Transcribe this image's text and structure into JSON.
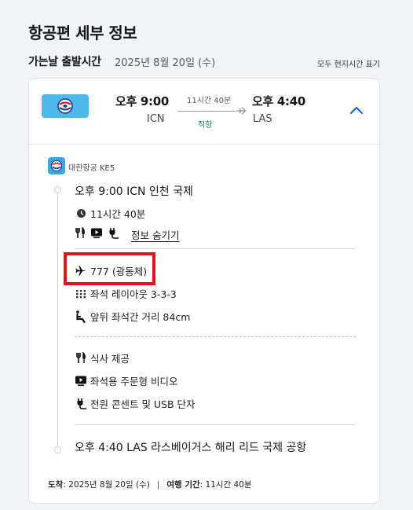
{
  "page_title": "항공편 세부 정보",
  "subheader": {
    "label": "가는날 출발시간",
    "date": "2025년 8월 20일 (수)",
    "note": "모두 현지시간 표기"
  },
  "summary": {
    "dep_time": "오후 9:00",
    "dep_code": "ICN",
    "duration": "11시간 40분",
    "stop_label": "직항",
    "arr_time": "오후 4:40",
    "arr_code": "LAS",
    "logo_color": "#4db8ec",
    "collapse_icon": "chevron-up-icon"
  },
  "segment": {
    "airline": "대한항공 KE5",
    "departure": "오후 9:00 ICN 인천 국제",
    "duration": "11시간 40분",
    "hide_label": "정보 숨기기",
    "aircraft": "777 (광동체)",
    "seat_layout": "좌석 레이아웃 3-3-3",
    "seat_pitch": "앞뒤 좌석간 거리 84cm",
    "amenities": {
      "meal": "식사 제공",
      "video": "좌석용 주문형 비디오",
      "power": "전원 콘센트 및 USB 단자"
    },
    "arrival": "오후 4:40 LAS 라스베이거스 해리 리드 국제 공항"
  },
  "footer": {
    "arrival_label": "도착",
    "arrival_value": ": 2025년 8월 20일 (수)",
    "separator": "|",
    "trip_label": "여행 기간",
    "trip_value": ": 11시간 40분"
  },
  "colors": {
    "highlight": "#e0131d",
    "link_blue": "#0b6fd6",
    "direct_green": "#0b7a6b"
  }
}
